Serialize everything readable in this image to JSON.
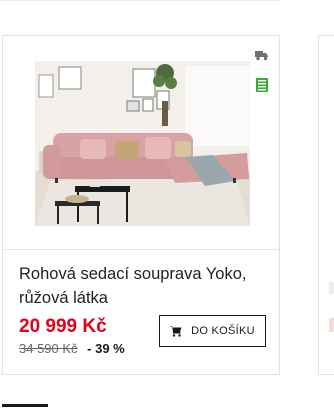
{
  "product": {
    "name": "Rohová sedací souprava Yoko, růžová látka",
    "price": "20 999 Kč",
    "old_price": "34 590 Kč",
    "discount": "- 39 %",
    "cart_button_label": "DO KOŠÍKU",
    "image_icon": "pink-corner-sofa-photo"
  },
  "badges": [
    {
      "icon": "delivery-truck-icon",
      "color": "#6f6f6f"
    },
    {
      "icon": "in-stock-icon",
      "color": "#3aa935"
    }
  ],
  "colors": {
    "price": "#e2001a",
    "sofa": "#d9a3a6",
    "stock_badge": "#3aa935"
  }
}
